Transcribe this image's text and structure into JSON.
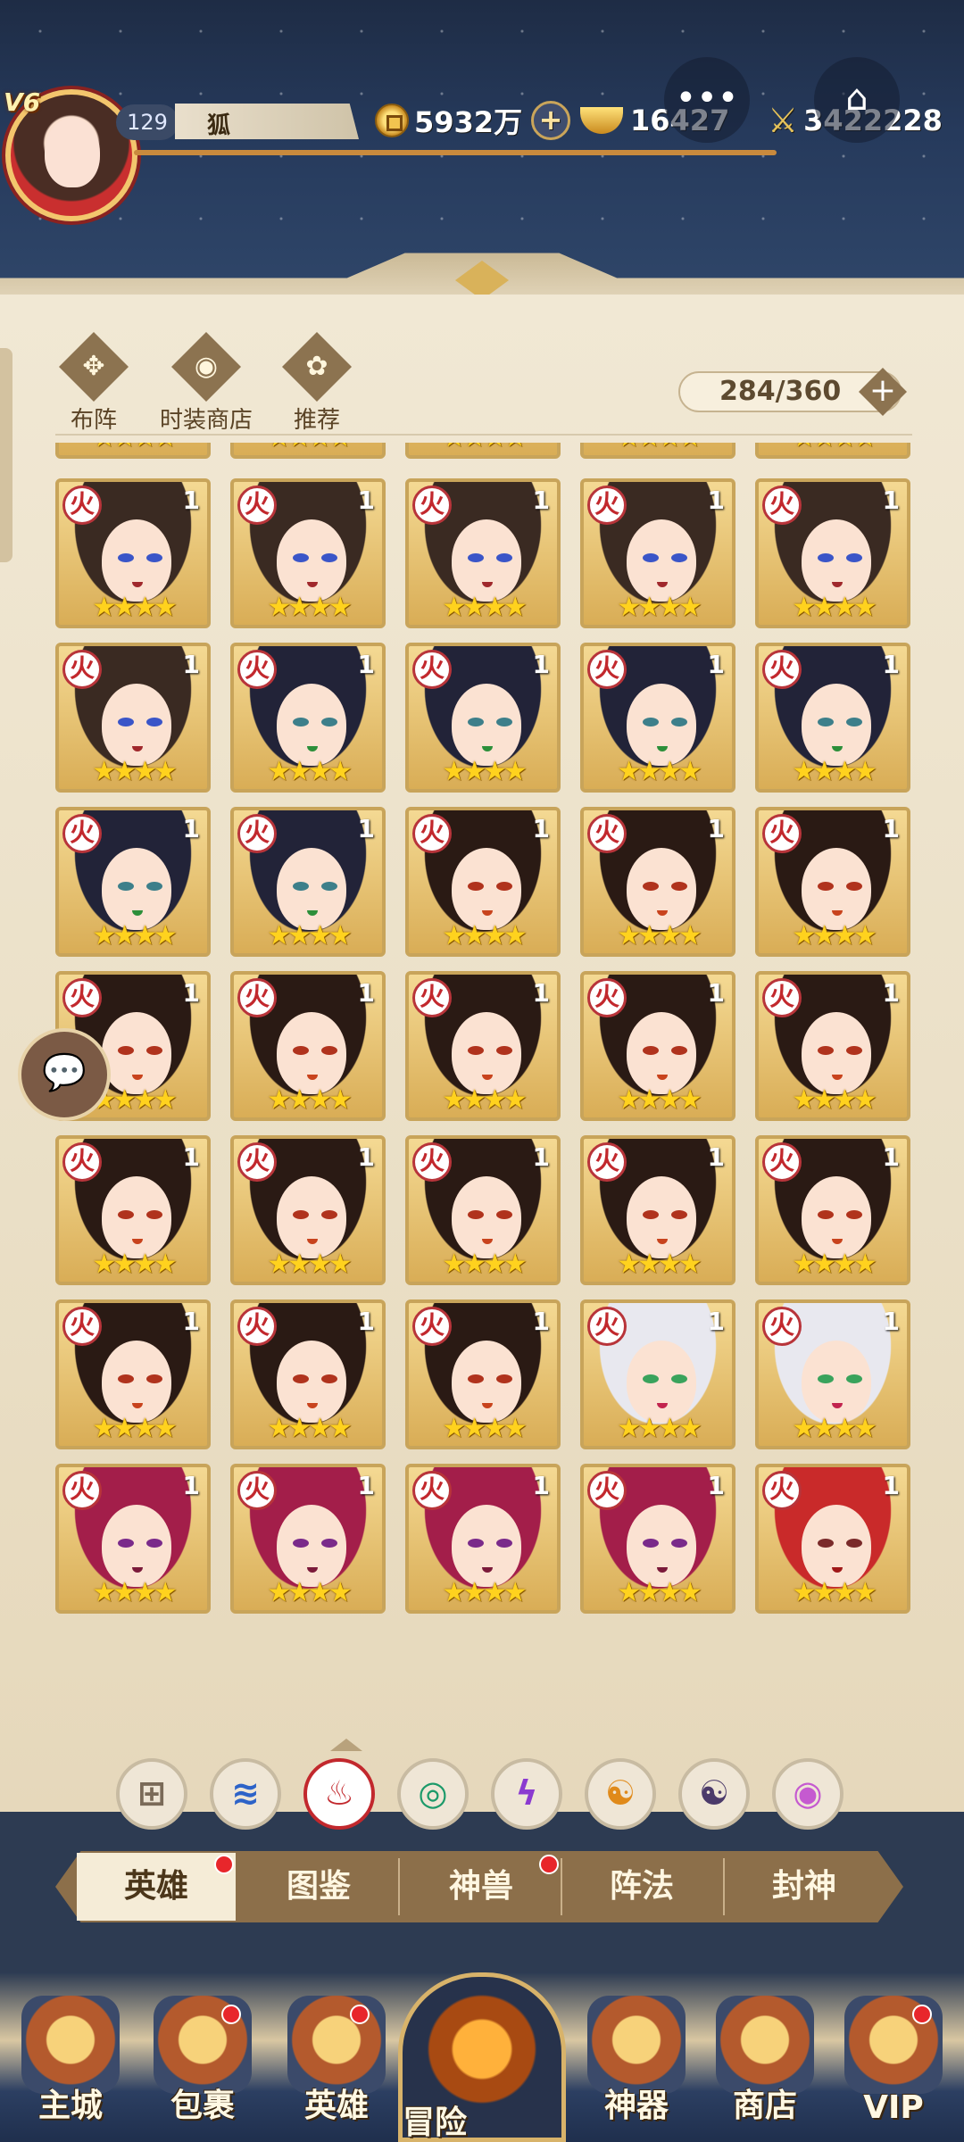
{
  "player": {
    "vip": "V6",
    "level": "129",
    "name": "狐"
  },
  "resources": {
    "coins": "5932万",
    "gold": "16427",
    "power": "3422228"
  },
  "tools": [
    {
      "label": "布阵",
      "icon": "formation-icon"
    },
    {
      "label": "时装商店",
      "icon": "fashion-shop-icon"
    },
    {
      "label": "推荐",
      "icon": "recommend-icon"
    }
  ],
  "hero_count": "284/360",
  "hero_grid": {
    "level": "1",
    "stars": "★★★★",
    "element_glyph": "火"
  },
  "filters": [
    {
      "name": "all-filter",
      "glyph": "⊞",
      "color": "#7a6a58"
    },
    {
      "name": "water-filter",
      "glyph": "≋",
      "color": "#2d63c8"
    },
    {
      "name": "fire-filter",
      "glyph": "♨",
      "color": "#c2282d"
    },
    {
      "name": "wind-filter",
      "glyph": "◎",
      "color": "#1c9a6a"
    },
    {
      "name": "thunder-filter",
      "glyph": "ϟ",
      "color": "#8b3ad0"
    },
    {
      "name": "light-filter",
      "glyph": "☯",
      "color": "#e08a1a"
    },
    {
      "name": "dark-filter",
      "glyph": "☯",
      "color": "#4b3a6a"
    },
    {
      "name": "special-filter",
      "glyph": "◉",
      "color": "#c55ad0"
    }
  ],
  "tabs": [
    "英雄",
    "图鉴",
    "神兽",
    "阵法",
    "封神"
  ],
  "nav": [
    "主城",
    "包裹",
    "英雄",
    "冒险",
    "神器",
    "商店",
    "VIP"
  ]
}
